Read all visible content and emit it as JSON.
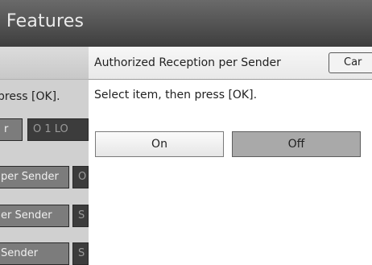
{
  "header": {
    "title": "e Features"
  },
  "sidebar": {
    "instruction": "press [OK].",
    "row1_left": "r",
    "row1_right": "O 1 LO",
    "items": [
      {
        "label": "per Sender",
        "side": "O"
      },
      {
        "label": "er Sender",
        "side": "S"
      },
      {
        "label": "Sender",
        "side": "S"
      }
    ]
  },
  "dialog": {
    "title": "Authorized Reception per Sender",
    "cancel_label": "Car",
    "message": "Select item, then press [OK].",
    "options": [
      {
        "label": "On",
        "selected": false
      },
      {
        "label": "Off",
        "selected": true
      }
    ]
  },
  "colors": {
    "title_bar": "#3e3e3e",
    "selected_option": "#a9a9a9",
    "side_button": "#7c7c7c"
  }
}
